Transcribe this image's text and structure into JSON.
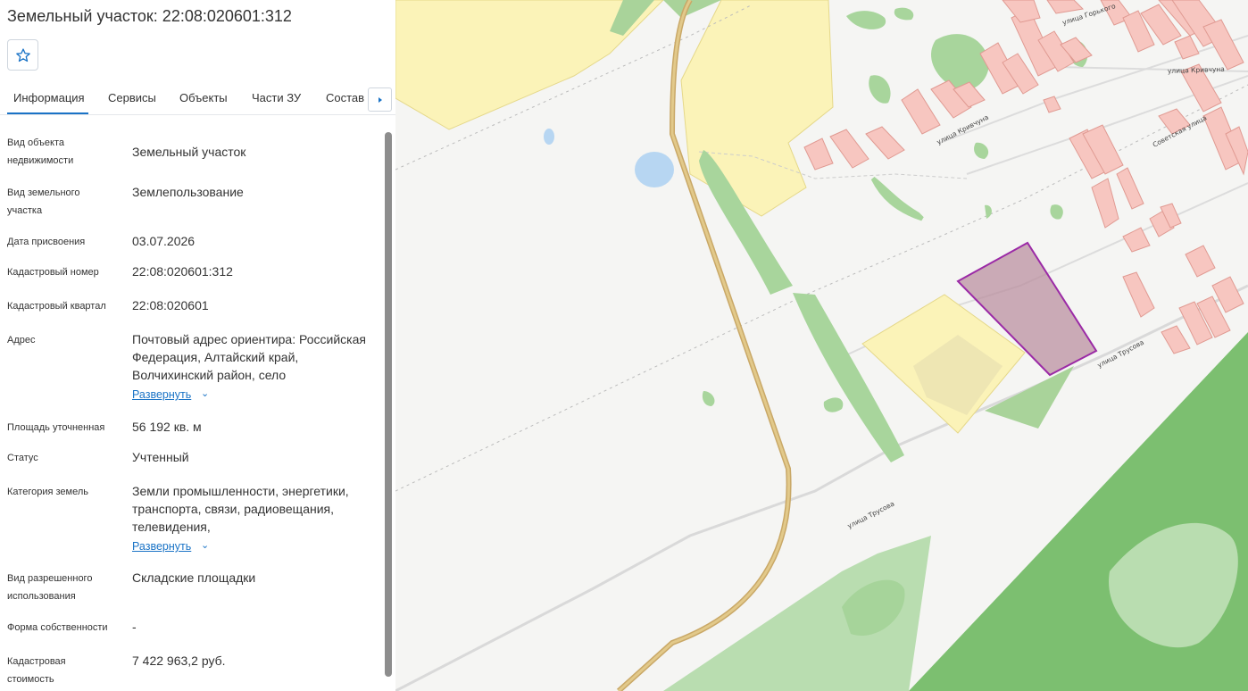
{
  "header": {
    "title": "Земельный участок: 22:08:020601:312"
  },
  "favorite": {
    "icon": "star-icon"
  },
  "tabs": [
    {
      "label": "Информация",
      "active": true
    },
    {
      "label": "Сервисы"
    },
    {
      "label": "Объекты"
    },
    {
      "label": "Части ЗУ"
    },
    {
      "label": "Состав"
    }
  ],
  "tabs_next_icon": "chevron-right-icon",
  "info": {
    "rows": [
      {
        "label": "Вид объекта недвижимости",
        "value": "Земельный участок"
      },
      {
        "label": "Вид земельного участка",
        "value": "Землепользование"
      },
      {
        "label": "Дата присвоения",
        "value": "03.07.2026"
      },
      {
        "label": "Кадастровый номер",
        "value": "22:08:020601:312"
      },
      {
        "label": "Кадастровый квартал",
        "value": "22:08:020601"
      },
      {
        "label": "Адрес",
        "value": "Почтовый адрес ориентира: Российская Федерация, Алтайский край, Волчихинский район, село",
        "expand": "Развернуть"
      },
      {
        "label": "Площадь уточненная",
        "value": "56 192 кв. м"
      },
      {
        "label": "Статус",
        "value": "Учтенный"
      },
      {
        "label": "Категория земель",
        "value": "Земли промышленности, энергетики, транспорта, связи, радиовещания, телевидения,",
        "expand": "Развернуть"
      },
      {
        "label": "Вид разрешенного использования",
        "value": "Складские площадки"
      },
      {
        "label": "Форма собственности",
        "value": "-"
      },
      {
        "label": "Кадастровая стоимость",
        "value": "7 422 963,2 руб."
      }
    ]
  },
  "map": {
    "streets": [
      "улица Горького",
      "улица Кривчуна",
      "улица Кривчуна",
      "Советская улица",
      "улица Трусова",
      "улица Трусова"
    ],
    "colors": {
      "background": "#f5f5f3",
      "parcel_fill": "#b88a9b",
      "parcel_stroke": "#9b2aa6",
      "forest": "#7cbf70",
      "light_forest": "#b9ddb0",
      "zone_yellow": "#fbf3b8",
      "road": "#c9a867",
      "buildings": "#f7c6c0",
      "water": "#b7d6f2"
    }
  }
}
